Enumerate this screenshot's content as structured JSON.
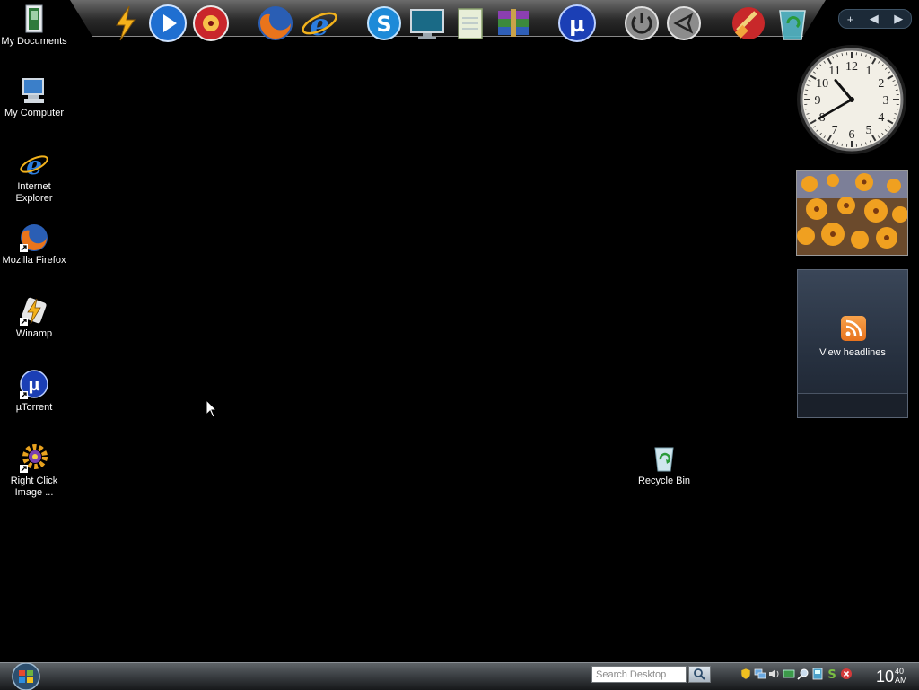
{
  "desktop": {
    "background_color": "#000000",
    "icons": [
      {
        "label": "My Documents",
        "icon": "folder-icon"
      },
      {
        "label": "My Computer",
        "icon": "computer-icon"
      },
      {
        "label": "Internet Explorer",
        "icon": "ie-icon"
      },
      {
        "label": "Mozilla Firefox",
        "icon": "firefox-icon"
      },
      {
        "label": "Winamp",
        "icon": "winamp-icon"
      },
      {
        "label": "µTorrent",
        "icon": "utorrent-icon"
      },
      {
        "label": "Right Click Image ...",
        "icon": "gear-icon"
      },
      {
        "label": "Recycle Bin",
        "icon": "recycle-bin-icon"
      }
    ]
  },
  "dock": {
    "items": [
      "winamp-icon",
      "play-icon",
      "burn-icon",
      "firefox-icon",
      "ie-icon",
      "skype-icon",
      "monitor-icon",
      "notepad-icon",
      "winrar-icon",
      "utorrent-icon",
      "power-icon",
      "back-icon",
      "ccleaner-icon",
      "recycle-bin-icon"
    ],
    "controls": [
      "+",
      "◀",
      "▶"
    ]
  },
  "sidebar": {
    "clock": {
      "hour": 10,
      "minute": 40,
      "numerals": [
        "12",
        "1",
        "2",
        "3",
        "4",
        "5",
        "6",
        "7",
        "8",
        "9",
        "10",
        "11"
      ]
    },
    "feed_headlines_label": "View headlines"
  },
  "taskbar": {
    "search_placeholder": "Search Desktop",
    "time_hour": "10",
    "time_minute": "40",
    "time_ampm": "AM",
    "tray_icons": [
      "shield-icon",
      "network-icon",
      "volume-icon",
      "network-activity-icon",
      "search-icon",
      "device-icon",
      "skype-icon",
      "close-icon"
    ]
  },
  "colors": {
    "accent": "#e8731d",
    "taskbar": "#3c4044"
  }
}
